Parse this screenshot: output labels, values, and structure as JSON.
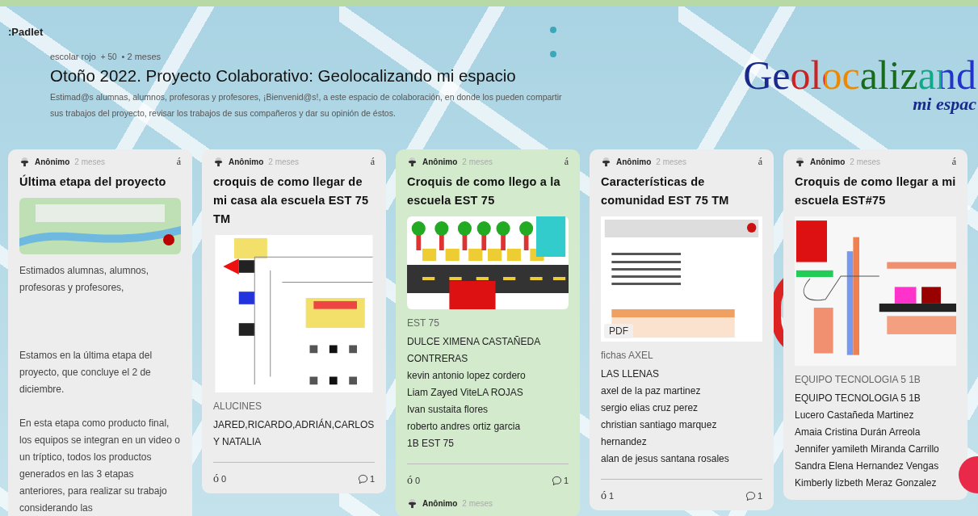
{
  "app": {
    "logo": ":Padlet"
  },
  "header": {
    "author": "escolar rojo",
    "followers": "+ 50",
    "time": "• 2 meses",
    "title": "Otoño 2022. Proyecto Colaborativo: Geolocalizando mi espacio",
    "description": "Estimad@s alumnas, alumnos, profesoras y profesores, ¡Bienvenid@s!, a este espacio de colaboración, en donde los pueden compartir sus trabajos del proyecto, revisar los trabajos de sus compañeros y dar su opinión de éstos.",
    "wallpaper_title": "Geolocalizand",
    "wallpaper_subtitle": "mi espac"
  },
  "posts": [
    {
      "author": "Anônimo",
      "time": "2 meses",
      "menu": "á",
      "title": "Última etapa del proyecto",
      "kind": "logo",
      "color": "#ededed",
      "paragraphs": [
        "Estimados alumnas, alumnos, profesoras y profesores,",
        "Estamos en la última etapa del proyecto, que concluye el 2 de diciembre.",
        "En esta etapa como producto final, los equipos se integran en un video o un tríptico, todos los productos generados en las 3 etapas anteriores, para realizar su trabajo considerando las"
      ]
    },
    {
      "author": "Anônimo",
      "time": "2 meses",
      "menu": "á",
      "title": "croquis de como llegar de mi casa ala escuela EST 75 TM",
      "kind": "sketch",
      "color": "#ededed",
      "caption": "ALUCINES",
      "paragraphs": [
        "JARED,RICARDO,ADRIÁN,CARLOS Y NATALIA"
      ],
      "likes_glyph": "ó",
      "likes": "0",
      "comments": "1"
    },
    {
      "author": "Anônimo",
      "time": "2 meses",
      "menu": "á",
      "title": "Croquis de como llego a la escuela EST 75",
      "kind": "street",
      "color": "#d3eacd",
      "caption": "EST 75",
      "paragraphs": [
        "DULCE XIMENA CASTAÑEDA CONTRERAS",
        "kevin antonio lopez cordero",
        "Liam Zayed ViteLA ROJAS",
        "Ivan sustaita flores",
        "roberto andres ortiz garcia",
        "1B EST 75"
      ],
      "likes_glyph": "ó",
      "likes": "0",
      "comments": "1",
      "comment_author": "Anônimo",
      "comment_time": "2 meses"
    },
    {
      "author": "Anônimo",
      "time": "2 meses",
      "menu": "á",
      "title": "Características de comunidad EST 75 TM",
      "kind": "document",
      "attachment": "PDF",
      "color": "#ededed",
      "caption": "fichas AXEL",
      "paragraphs": [
        "LAS LLENAS",
        "axel de la paz martinez",
        "sergio elias cruz perez",
        "christian santiago marquez hernandez",
        "alan de jesus santana rosales"
      ],
      "likes_glyph": "ó",
      "likes": "1",
      "comments": "1"
    },
    {
      "author": "Anônimo",
      "time": "2 meses",
      "menu": "á",
      "title": "Croquis de como llegar a mi escuela EST#75",
      "kind": "map",
      "color": "#ededed",
      "caption": "EQUIPO TECNOLOGIA 5 1B",
      "paragraphs": [
        "EQUIPO TECNOLOGIA 5 1B",
        "Lucero Castañeda Martinez",
        "Amaia Cristina Durán Arreola",
        "Jennifer yamileth Miranda Carrillo",
        "Sandra Elena Hernandez Vengas",
        "Kimberly lizbeth Meraz Gonzalez"
      ]
    }
  ]
}
